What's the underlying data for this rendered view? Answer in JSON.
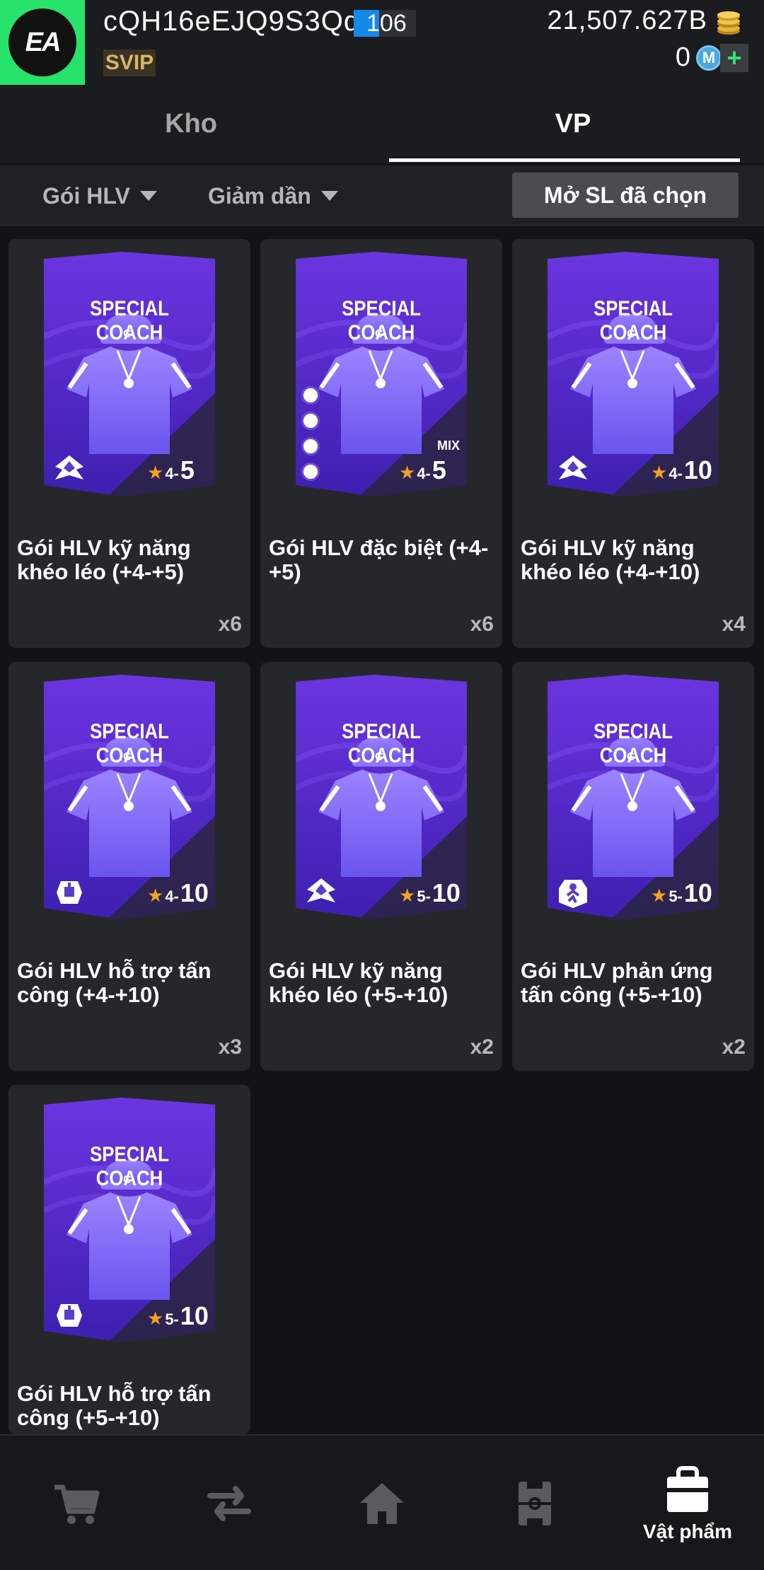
{
  "header": {
    "logo_text": "EA",
    "username": "cQH16eEJQ9S3Qq",
    "level": "106",
    "vip_label": "SVIP",
    "coins": "21,507.627B",
    "m_coins": "0",
    "m_icon_letter": "M",
    "add_label": "+"
  },
  "tabs": [
    {
      "label": "Kho",
      "active": false
    },
    {
      "label": "VP",
      "active": true
    }
  ],
  "filters": {
    "type": "Gói HLV",
    "sort": "Giảm dần",
    "open_selected": "Mở SL đã chọn"
  },
  "pack_title": "SPECIAL COACH",
  "cap_letter": "C",
  "star": "★",
  "items": [
    {
      "name": "Gói HLV kỹ năng khéo léo (+4-+5)",
      "min": "4",
      "max": "5",
      "count": "x6",
      "icon": "dribble-skill-icon",
      "mix": ""
    },
    {
      "name": "Gói HLV đặc biệt (+4-+5)",
      "min": "4",
      "max": "5",
      "count": "x6",
      "icon": "mixed-skills-icon",
      "mix": "MIX"
    },
    {
      "name": "Gói HLV kỹ năng khéo léo (+4-+10)",
      "min": "4",
      "max": "10",
      "count": "x4",
      "icon": "dribble-skill-icon",
      "mix": ""
    },
    {
      "name": "Gói HLV hỗ trợ tấn công (+4-+10)",
      "min": "4",
      "max": "10",
      "count": "x3",
      "icon": "attack-support-icon",
      "mix": ""
    },
    {
      "name": "Gói HLV kỹ năng khéo léo (+5-+10)",
      "min": "5",
      "max": "10",
      "count": "x2",
      "icon": "dribble-skill-icon",
      "mix": ""
    },
    {
      "name": "Gói HLV phản ứng tấn công (+5-+10)",
      "min": "5",
      "max": "10",
      "count": "x2",
      "icon": "attack-reaction-icon",
      "mix": ""
    },
    {
      "name": "Gói HLV hỗ trợ tấn công (+5-+10)",
      "min": "5",
      "max": "10",
      "count": "",
      "icon": "attack-support-icon",
      "mix": ""
    }
  ],
  "bottom_nav": [
    {
      "icon": "cart-icon",
      "label": ""
    },
    {
      "icon": "transfer-icon",
      "label": ""
    },
    {
      "icon": "home-icon",
      "label": ""
    },
    {
      "icon": "field-icon",
      "label": ""
    },
    {
      "icon": "bag-icon",
      "label": "Vật phẩm",
      "active": true
    }
  ]
}
